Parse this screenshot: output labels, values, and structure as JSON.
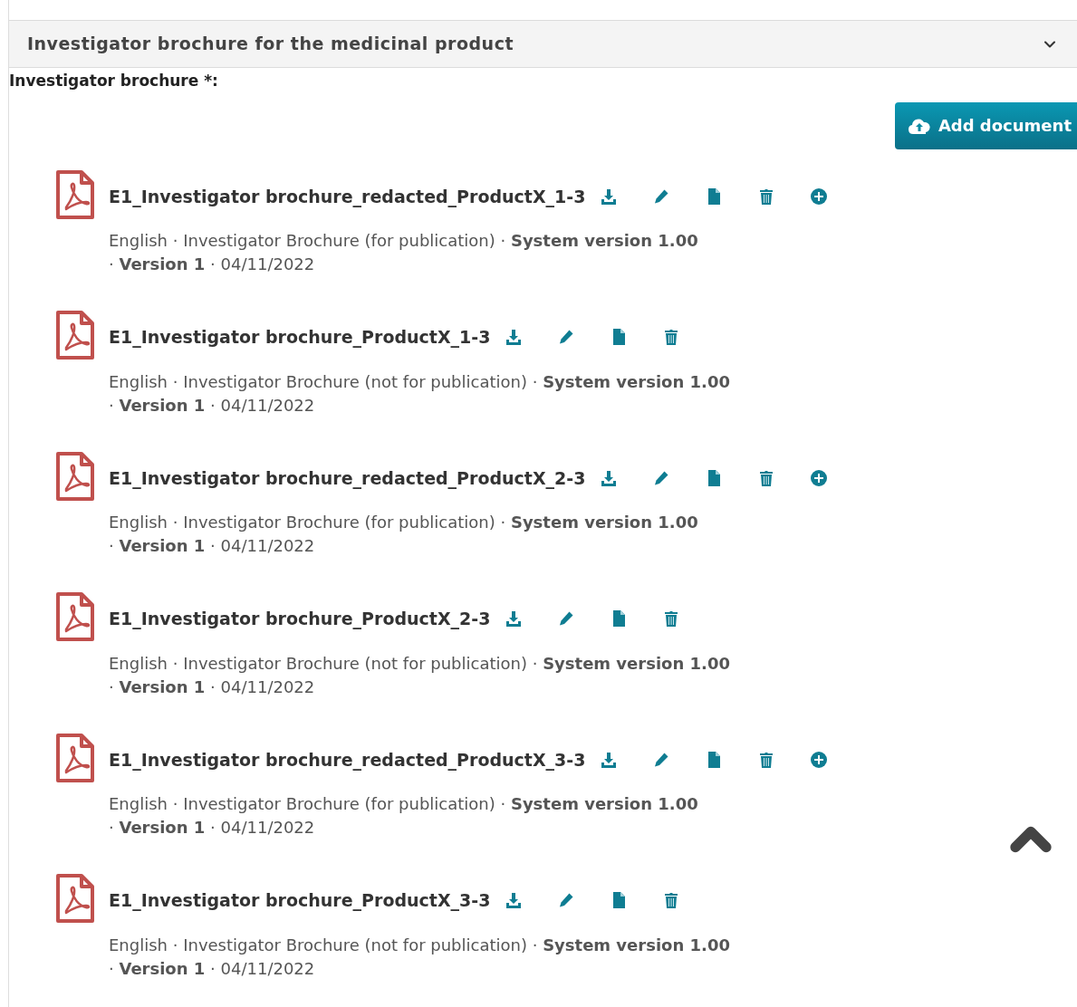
{
  "section": {
    "title": "Investigator brochure for the medicinal product",
    "expanded": true
  },
  "field_label": "Investigator brochure *:",
  "add_button": "Add document",
  "documents": [
    {
      "name": "E1_Investigator brochure_redacted_ProductX_1-3",
      "meta": "English · Investigator Brochure (for publication) · **System version 1.00** · **Version 1** · 04/11/2022",
      "actions": [
        {
          "kind": "download"
        },
        {
          "kind": "edit"
        },
        {
          "kind": "file"
        },
        {
          "kind": "delete"
        },
        {
          "kind": "add"
        }
      ]
    },
    {
      "name": "E1_Investigator brochure_ProductX_1-3",
      "meta": "English · Investigator Brochure (not for publication) · **System version 1.00** · **Version 1** · 04/11/2022",
      "actions": [
        {
          "kind": "download"
        },
        {
          "kind": "edit"
        },
        {
          "kind": "file"
        },
        {
          "kind": "delete"
        }
      ]
    },
    {
      "name": "E1_Investigator brochure_redacted_ProductX_2-3",
      "meta": "English · Investigator Brochure (for publication) · **System version 1.00** · **Version 1** · 04/11/2022",
      "actions": [
        {
          "kind": "download"
        },
        {
          "kind": "edit"
        },
        {
          "kind": "file"
        },
        {
          "kind": "delete"
        },
        {
          "kind": "add"
        }
      ]
    },
    {
      "name": "E1_Investigator brochure_ProductX_2-3",
      "meta": "English · Investigator Brochure (not for publication) · **System version 1.00** · **Version 1** · 04/11/2022",
      "actions": [
        {
          "kind": "download"
        },
        {
          "kind": "edit"
        },
        {
          "kind": "file"
        },
        {
          "kind": "delete"
        }
      ]
    },
    {
      "name": "E1_Investigator brochure_redacted_ProductX_3-3",
      "meta": "English · Investigator Brochure (for publication) · **System version 1.00** · **Version 1** · 04/11/2022",
      "actions": [
        {
          "kind": "download"
        },
        {
          "kind": "edit"
        },
        {
          "kind": "file"
        },
        {
          "kind": "delete"
        },
        {
          "kind": "add"
        }
      ]
    },
    {
      "name": "E1_Investigator brochure_ProductX_3-3",
      "meta": "English · Investigator Brochure (not for publication) · **System version 1.00** · **Version 1** · 04/11/2022",
      "actions": [
        {
          "kind": "download"
        },
        {
          "kind": "edit"
        },
        {
          "kind": "file"
        },
        {
          "kind": "delete"
        }
      ]
    }
  ]
}
